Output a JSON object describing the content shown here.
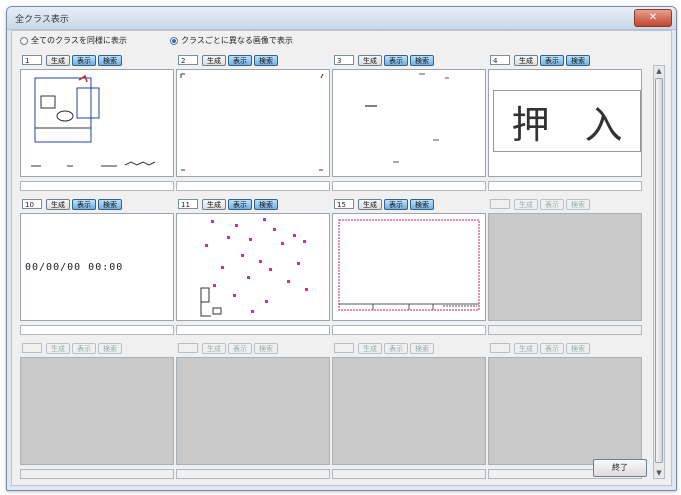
{
  "window": {
    "title": "全クラス表示",
    "close_label": "✕"
  },
  "options": {
    "radio_all": "全てのクラスを同様に表示",
    "radio_each": "クラスごとに異なる画像で表示",
    "selected": "radio_each"
  },
  "buttons": {
    "generate": "生成",
    "show": "表示",
    "search": "検索",
    "end": "終了"
  },
  "panels": [
    {
      "number": "1",
      "active": true
    },
    {
      "number": "2",
      "active": true
    },
    {
      "number": "3",
      "active": true
    },
    {
      "number": "4",
      "active": true,
      "text_chars": [
        "押",
        "入"
      ]
    },
    {
      "number": "10",
      "active": true,
      "datetime": "00/00/00 00:00"
    },
    {
      "number": "11",
      "active": true
    },
    {
      "number": "15",
      "active": true
    },
    {
      "number": "",
      "active": false
    },
    {
      "number": "",
      "active": false
    },
    {
      "number": "",
      "active": false
    },
    {
      "number": "",
      "active": false
    },
    {
      "number": "",
      "active": false
    }
  ],
  "colors": {
    "accent_button": "#6fb2e2",
    "empty_preview": "#c9c9c9",
    "magenta_marks": "#e020b0",
    "red_frame": "#d02050"
  }
}
